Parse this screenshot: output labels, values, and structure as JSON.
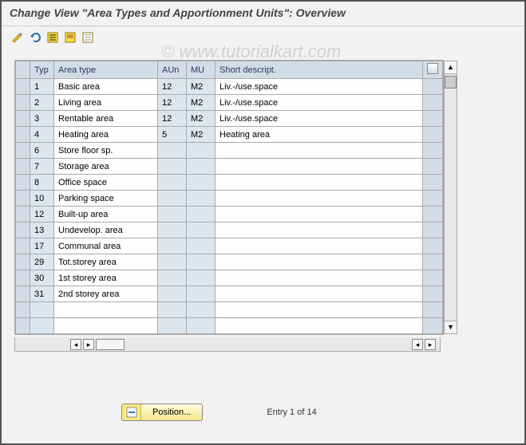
{
  "title": "Change View \"Area Types and Apportionment Units\": Overview",
  "watermark": "© www.tutorialkart.com",
  "columns": {
    "typ": "Typ",
    "area": "Area type",
    "aun": "AUn",
    "mu": "MU",
    "desc": "Short descript."
  },
  "rows": [
    {
      "typ": "1",
      "area": "Basic area",
      "aun": "12",
      "mu": "M2",
      "desc": "Liv.-/use.space"
    },
    {
      "typ": "2",
      "area": "Living area",
      "aun": "12",
      "mu": "M2",
      "desc": "Liv.-/use.space"
    },
    {
      "typ": "3",
      "area": "Rentable area",
      "aun": "12",
      "mu": "M2",
      "desc": "Liv.-/use.space"
    },
    {
      "typ": "4",
      "area": "Heating area",
      "aun": "5",
      "mu": "M2",
      "desc": "Heating area"
    },
    {
      "typ": "6",
      "area": "Store floor sp.",
      "aun": "",
      "mu": "",
      "desc": ""
    },
    {
      "typ": "7",
      "area": "Storage area",
      "aun": "",
      "mu": "",
      "desc": ""
    },
    {
      "typ": "8",
      "area": "Office space",
      "aun": "",
      "mu": "",
      "desc": ""
    },
    {
      "typ": "10",
      "area": "Parking space",
      "aun": "",
      "mu": "",
      "desc": ""
    },
    {
      "typ": "12",
      "area": "Built-up area",
      "aun": "",
      "mu": "",
      "desc": ""
    },
    {
      "typ": "13",
      "area": "Undevelop. area",
      "aun": "",
      "mu": "",
      "desc": ""
    },
    {
      "typ": "17",
      "area": "Communal area",
      "aun": "",
      "mu": "",
      "desc": ""
    },
    {
      "typ": "29",
      "area": "Tot.storey area",
      "aun": "",
      "mu": "",
      "desc": ""
    },
    {
      "typ": "30",
      "area": "1st storey area",
      "aun": "",
      "mu": "",
      "desc": ""
    },
    {
      "typ": "31",
      "area": "2nd storey area",
      "aun": "",
      "mu": "",
      "desc": ""
    },
    {
      "typ": "",
      "area": "",
      "aun": "",
      "mu": "",
      "desc": ""
    },
    {
      "typ": "",
      "area": "",
      "aun": "",
      "mu": "",
      "desc": ""
    }
  ],
  "footer": {
    "position_label": "Position...",
    "entry_text": "Entry 1 of 14"
  },
  "toolbar_icons": [
    "change-icon",
    "undo-icon",
    "select-all-icon",
    "select-block-icon",
    "deselect-all-icon"
  ]
}
